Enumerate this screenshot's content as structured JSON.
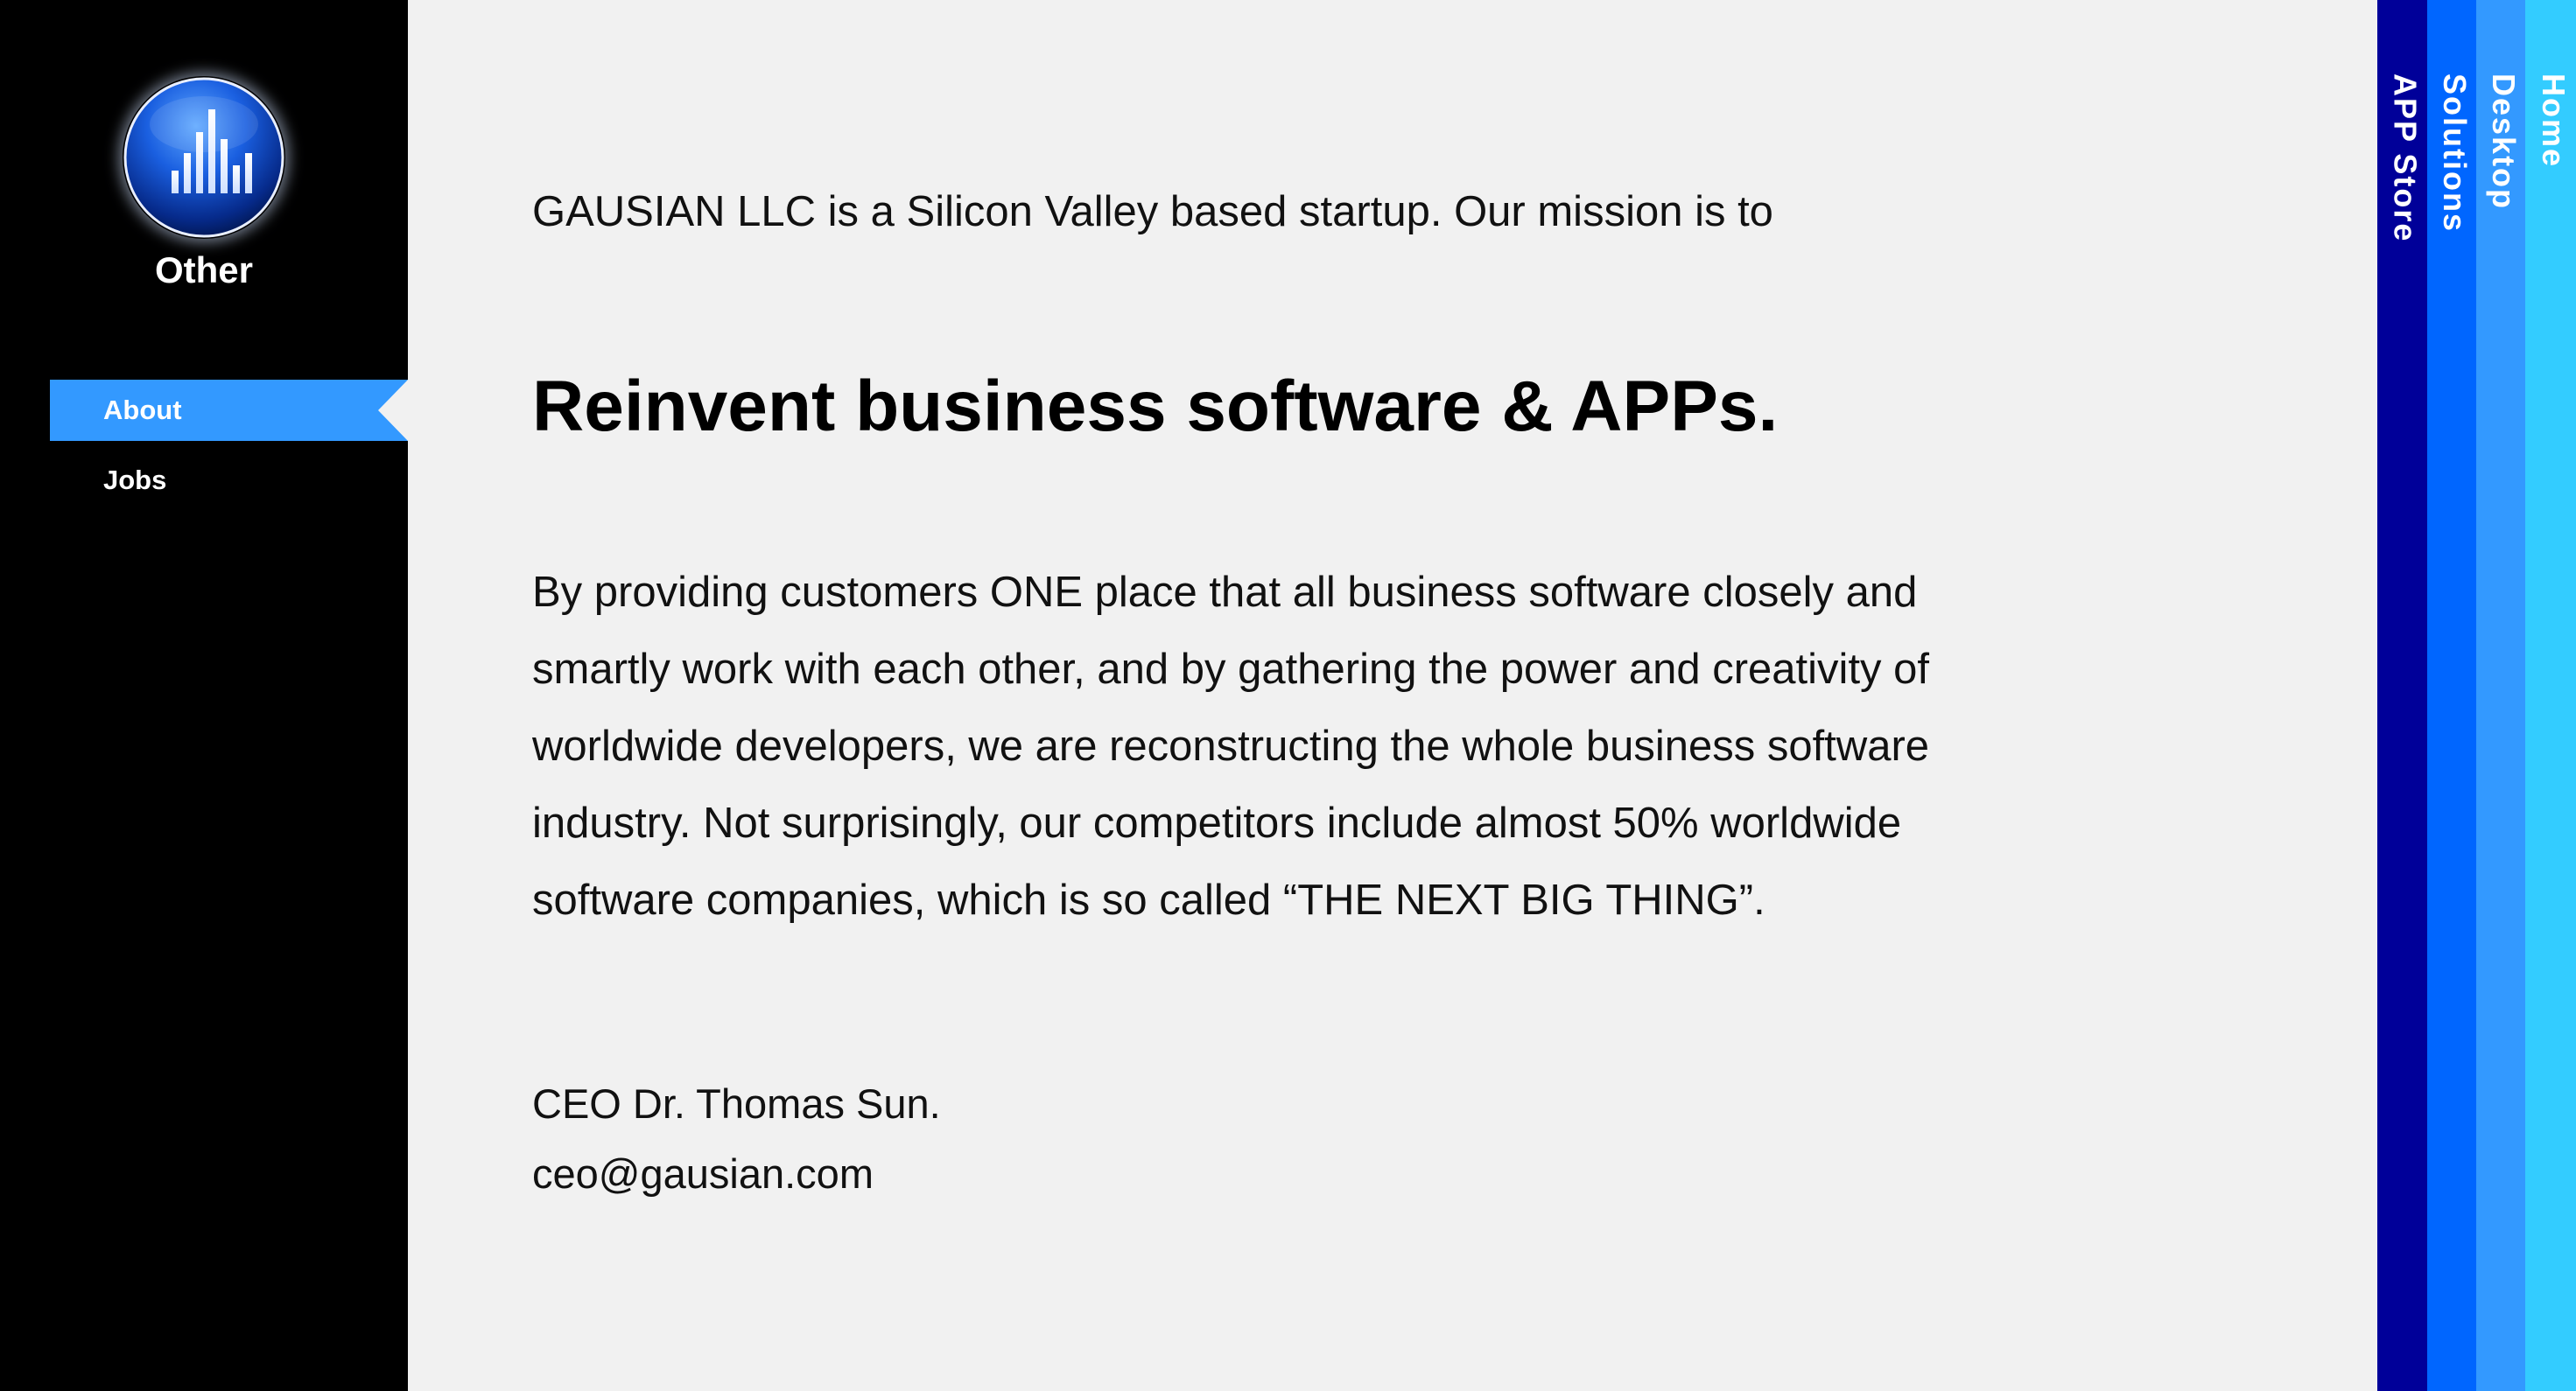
{
  "sidebar": {
    "section_title": "Other",
    "logo_icon": "bar-chart-globe-icon",
    "items": [
      {
        "label": "About",
        "active": true
      },
      {
        "label": "Jobs",
        "active": false
      }
    ]
  },
  "content": {
    "intro": "GAUSIAN LLC is a Silicon Valley based startup. Our mission is to",
    "headline": "Reinvent business software & APPs.",
    "description_lines": [
      "By providing customers ONE place that all business software closely and",
      "smartly work with each other, and by gathering the power and creativity of",
      "worldwide developers, we are reconstructing the whole business software",
      "industry. Not surprisingly, our competitors include almost 50% worldwide",
      "software companies, which is so called “THE NEXT BIG THING”."
    ],
    "signature_name": "CEO Dr. Thomas Sun.",
    "signature_email": "ceo@gausian.com"
  },
  "rightnav": {
    "tabs": [
      {
        "label": "APP Store",
        "color": "#000099"
      },
      {
        "label": "Solutions",
        "color": "#0066ff"
      },
      {
        "label": "Desktop",
        "color": "#3399ff"
      },
      {
        "label": "Home",
        "color": "#33ccff"
      }
    ]
  },
  "colors": {
    "sidebar_bg": "#000000",
    "active_item": "#3399ff",
    "content_bg": "#f1f1f1"
  }
}
